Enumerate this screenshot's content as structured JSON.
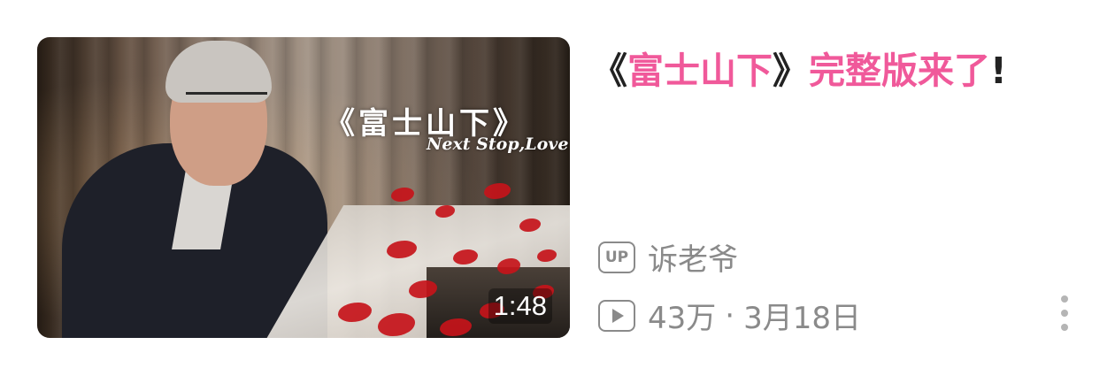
{
  "video": {
    "thumbnail": {
      "overlay_title": "《富士山下》",
      "overlay_subtitle": "Next Stop,Love",
      "duration": "1:48"
    },
    "title": {
      "open_bracket": "《",
      "highlight_1": "富士山下",
      "close_bracket": "》",
      "highlight_2": "完整版来了",
      "suffix": "!"
    },
    "uploader": {
      "badge": "UP",
      "name": "诉老爷"
    },
    "stats": {
      "views": "43万",
      "separator": "·",
      "date": "3月18日"
    }
  },
  "colors": {
    "highlight": "#f0599a",
    "meta_text": "#8a8a8a"
  },
  "icons": {
    "uploader": "up-badge-icon",
    "views": "play-count-icon",
    "menu": "more-vertical-icon"
  }
}
